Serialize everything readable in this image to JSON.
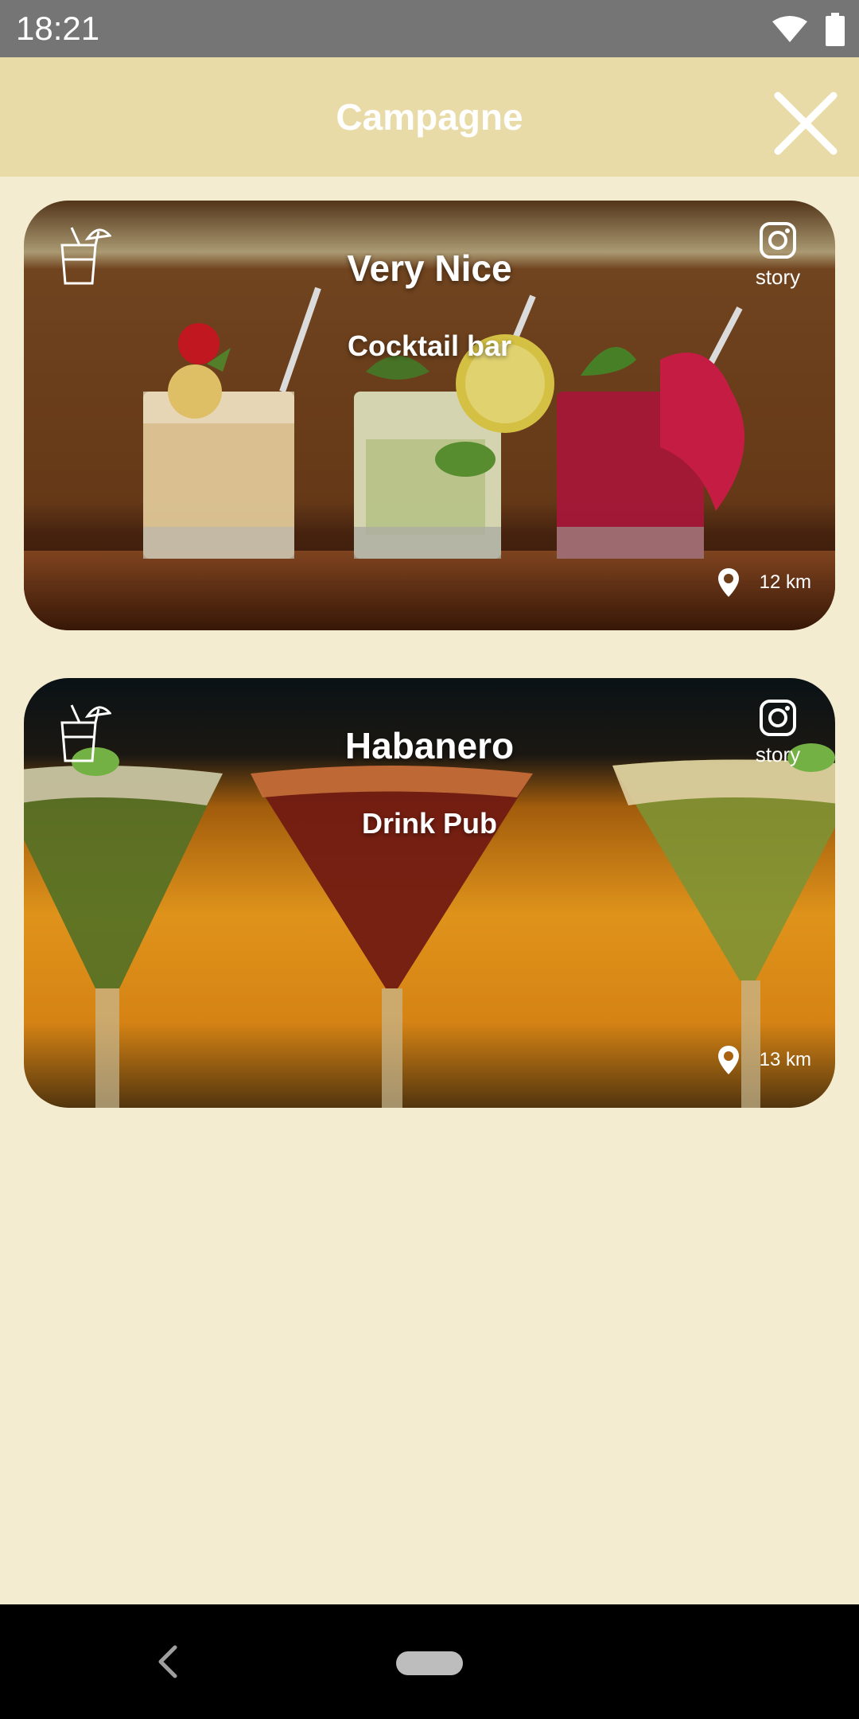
{
  "status_bar": {
    "time": "18:21",
    "icons": [
      "wifi-icon",
      "battery-icon"
    ]
  },
  "header": {
    "title": "Campagne",
    "close_icon": "close-icon"
  },
  "venues": [
    {
      "name": "Very Nice",
      "type": "Cocktail bar",
      "story_label": "story",
      "distance": "12 km",
      "category_icon": "cocktail-icon"
    },
    {
      "name": "Habanero",
      "type": "Drink Pub",
      "story_label": "story",
      "distance": "13 km",
      "category_icon": "cocktail-icon"
    }
  ],
  "nav_bar": {
    "back_icon": "back-icon",
    "home_icon": "home-pill-icon"
  },
  "colors": {
    "header_bg": "#e8dba7",
    "page_bg": "#f3ecd0",
    "status_bar_bg": "#757575",
    "nav_bar_bg": "#000000",
    "text_on_image": "#ffffff"
  }
}
